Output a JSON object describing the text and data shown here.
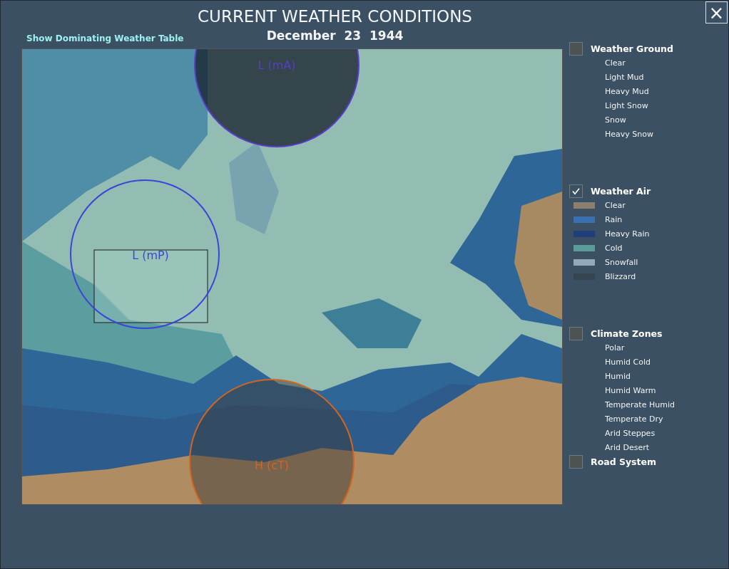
{
  "window": {
    "title": "CURRENT WEATHER CONDITIONS",
    "date": "December  23  1944",
    "close": "×"
  },
  "link": "Show Dominating Weather Table",
  "map": {
    "pressure_systems": [
      {
        "label": "L (mA)",
        "color": "#5a3ccc"
      },
      {
        "label": "L (mP)",
        "color": "#3a46d8"
      },
      {
        "label": "H (cT)",
        "color": "#d4651e"
      }
    ]
  },
  "legend": [
    {
      "title": "Weather Ground",
      "checked": false,
      "items": [
        {
          "label": "Clear"
        },
        {
          "label": "Light Mud"
        },
        {
          "label": "Heavy Mud"
        },
        {
          "label": "Light Snow"
        },
        {
          "label": "Snow"
        },
        {
          "label": "Heavy Snow"
        }
      ]
    },
    {
      "title": "Weather Air",
      "checked": true,
      "items": [
        {
          "label": "Clear",
          "color": "#8c7f70"
        },
        {
          "label": "Rain",
          "color": "#3a6fb0"
        },
        {
          "label": "Heavy Rain",
          "color": "#1f3f7a"
        },
        {
          "label": "Cold",
          "color": "#5a9a98"
        },
        {
          "label": "Snowfall",
          "color": "#93a8b8"
        },
        {
          "label": "Blizzard",
          "color": "#34454f"
        }
      ]
    },
    {
      "title": "Climate Zones",
      "checked": false,
      "items": [
        {
          "label": "Polar"
        },
        {
          "label": "Humid Cold"
        },
        {
          "label": "Humid"
        },
        {
          "label": "Humid Warm"
        },
        {
          "label": "Temperate Humid"
        },
        {
          "label": "Temperate Dry"
        },
        {
          "label": "Arid Steppes"
        },
        {
          "label": "Arid Desert"
        }
      ]
    },
    {
      "title": "Road System",
      "checked": false
    }
  ]
}
